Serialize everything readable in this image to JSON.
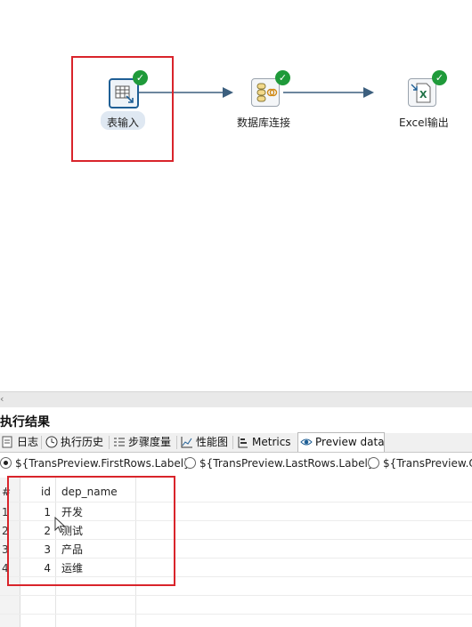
{
  "flow": {
    "steps": [
      {
        "label": "表输入",
        "icon": "table-input-icon",
        "status": "success"
      },
      {
        "label": "数据库连接",
        "icon": "database-lookup-icon",
        "status": "success"
      },
      {
        "label": "Excel输出",
        "icon": "excel-output-icon",
        "status": "success"
      }
    ]
  },
  "results": {
    "title": "执行结果",
    "tabs": [
      {
        "label": "日志",
        "icon": "log-icon"
      },
      {
        "label": "执行历史",
        "icon": "history-icon"
      },
      {
        "label": "步骤度量",
        "icon": "step-metrics-icon"
      },
      {
        "label": "性能图",
        "icon": "performance-chart-icon"
      },
      {
        "label": "Metrics",
        "icon": "metrics-icon"
      },
      {
        "label": "Preview data",
        "icon": "preview-eye-icon"
      }
    ],
    "active_tab": "Preview data",
    "radio_options": [
      {
        "label": "${TransPreview.FirstRows.Label}",
        "selected": true
      },
      {
        "label": "${TransPreview.LastRows.Label}",
        "selected": false
      },
      {
        "label": "${TransPreview.O",
        "selected": false
      }
    ],
    "table": {
      "columns": [
        "#",
        "id",
        "dep_name"
      ],
      "rows": [
        {
          "num": "1",
          "id": "1",
          "dep_name": "开发"
        },
        {
          "num": "2",
          "id": "2",
          "dep_name": "测试"
        },
        {
          "num": "3",
          "id": "3",
          "dep_name": "产品"
        },
        {
          "num": "4",
          "id": "4",
          "dep_name": "运维"
        }
      ]
    }
  },
  "colors": {
    "highlight_box": "#d9242b",
    "success": "#1f9a3a",
    "hop_arrow": "#3c5f7e",
    "selected_step": "#1f5f95"
  }
}
